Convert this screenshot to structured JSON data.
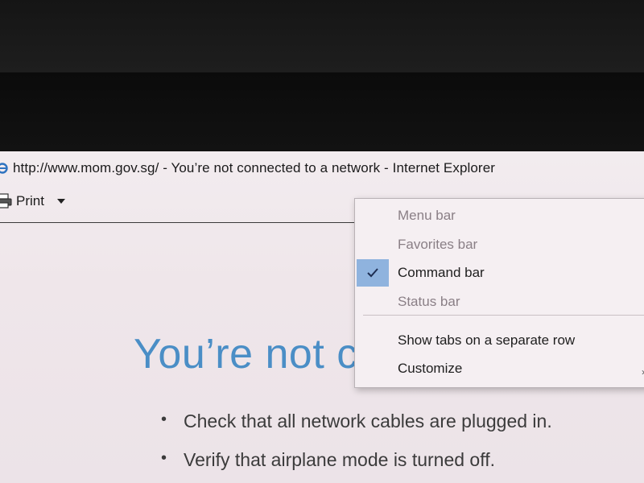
{
  "window": {
    "title": "http://www.mom.gov.sg/ - You’re not connected to a network - Internet Explorer"
  },
  "command_bar": {
    "print_label": "Print"
  },
  "page": {
    "heading": "You’re not c",
    "bullets": [
      "Check that all network cables are plugged in.",
      "Verify that airplane mode is turned off."
    ],
    "bullet_char": "•"
  },
  "context_menu": {
    "items": [
      {
        "label": "Menu bar",
        "checked": false,
        "enabled": false
      },
      {
        "label": "Favorites bar",
        "checked": false,
        "enabled": false
      },
      {
        "label": "Command bar",
        "checked": true,
        "enabled": true
      },
      {
        "label": "Status bar",
        "checked": false,
        "enabled": false
      },
      {
        "label": "Show tabs on a separate row",
        "checked": false,
        "enabled": true
      },
      {
        "label": "Customize",
        "checked": false,
        "enabled": true,
        "has_submenu": true
      }
    ],
    "checkmark": "✔",
    "submenu_arrow": "›"
  },
  "icons": {
    "window_icon": "internet-explorer-icon",
    "print_icon": "printer-icon",
    "dropdown_icon": "chevron-down-icon",
    "check_icon": "checkmark-icon"
  },
  "colors": {
    "heading": "#4a8ec6",
    "menu_check_highlight": "#8fb3de",
    "disabled_text": "#8a7f86"
  }
}
